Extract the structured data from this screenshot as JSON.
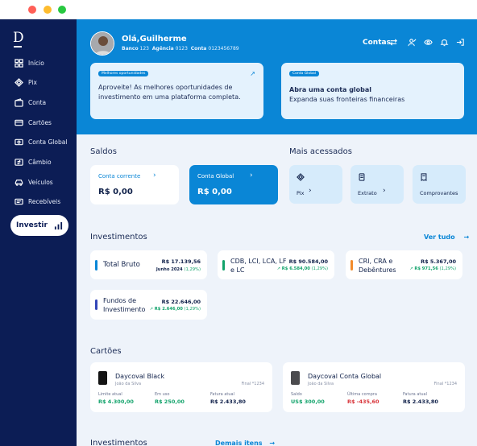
{
  "sidebar": {
    "logo": "D",
    "items": [
      {
        "label": "Início",
        "icon": "grid-icon"
      },
      {
        "label": "Pix",
        "icon": "pix-icon"
      },
      {
        "label": "Conta",
        "icon": "wallet-icon"
      },
      {
        "label": "Cartões",
        "icon": "card-icon"
      },
      {
        "label": "Conta Global",
        "icon": "globe-icon"
      },
      {
        "label": "Câmbio",
        "icon": "exchange-icon"
      },
      {
        "label": "Veículos",
        "icon": "car-icon"
      },
      {
        "label": "Recebíveis",
        "icon": "receivables-icon"
      }
    ],
    "invest_button": "Investir"
  },
  "header": {
    "greeting": "Olá,Guilherme",
    "bank_label": "Banco",
    "bank": "123",
    "agency_label": "Agência",
    "agency": "0123",
    "account_label": "Conta",
    "account": "0123456789",
    "accounts_button": "Contas"
  },
  "promo_cards": [
    {
      "tag": "Melhores oportunidades",
      "text": "Aproveite! As melhores oportunidades de investimento em uma plataforma completa."
    },
    {
      "tag": "Conta Global",
      "title": "Abra uma conta global",
      "text": "Expanda suas fronteiras financeiras"
    }
  ],
  "balances": {
    "title": "Saldos",
    "items": [
      {
        "label": "Conta corrente",
        "value": "R$ 0,00"
      },
      {
        "label": "Conta Global",
        "value": "R$ 0,00"
      }
    ]
  },
  "most_accessed": {
    "title": "Mais acessados",
    "items": [
      {
        "label": "Pix",
        "icon": "pix-icon"
      },
      {
        "label": "Extrato",
        "icon": "statement-icon"
      },
      {
        "label": "Comprovantes",
        "icon": "receipt-icon"
      }
    ]
  },
  "investments": {
    "title": "Investimentos",
    "see_all": "Ver tudo",
    "items": [
      {
        "name": "Total Bruto",
        "value": "R$ 17.139,56",
        "sub": "Junho 2024",
        "sub_pct": "(1,29%)",
        "color": "#0a86d6"
      },
      {
        "name": "CDB, LCI, LCA, LF e LC",
        "value": "R$ 90.584,00",
        "sub": "R$ 6.584,00",
        "sub_pct": "(1,29%)",
        "color": "#12a36b"
      },
      {
        "name": "CRI, CRA e Debêntures",
        "value": "R$ 5.367,00",
        "sub": "R$ 971,56",
        "sub_pct": "(1,29%)",
        "color": "#f28b2b"
      },
      {
        "name": "Fundos de Investimento",
        "value": "R$ 22.646,00",
        "sub": "R$ 2.646,00",
        "sub_pct": "(1,29%)",
        "color": "#3346b8"
      }
    ]
  },
  "cards": {
    "title": "Cartões",
    "items": [
      {
        "name": "Daycoval Black",
        "holder": "João da Silva",
        "final": "Final *1234",
        "l1": "Limite atual",
        "v1": "R$ 4.300,00",
        "l2": "Em uso",
        "v2": "R$ 250,00",
        "l3": "Fatura atual",
        "v3": "R$ 2.433,80"
      },
      {
        "name": "Daycoval Conta Global",
        "holder": "João da Silva",
        "final": "Final *1234",
        "l1": "Saldo",
        "v1": "US$ 300,00",
        "l2": "Última compra",
        "v2": "R$ -435,60",
        "l3": "Fatura atual",
        "v3": "R$ 2.433,80"
      }
    ]
  },
  "bottom": {
    "title": "Investimentos",
    "link": "Demais itens"
  }
}
